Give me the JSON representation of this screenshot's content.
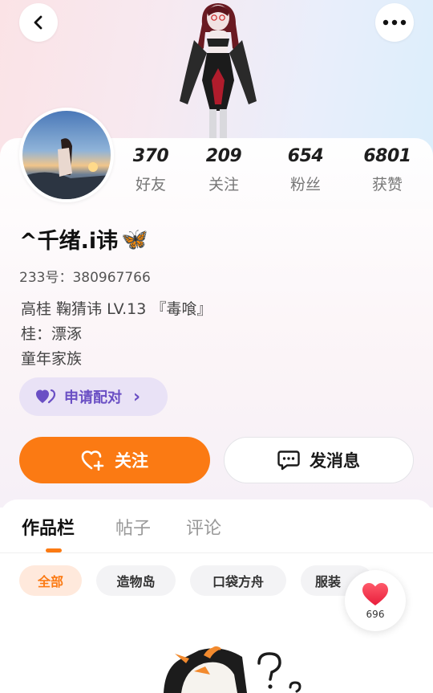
{
  "header": {
    "back_icon": "chevron-left-icon",
    "more_icon": "more-horizontal-icon"
  },
  "stats": [
    {
      "value": "370",
      "label": "好友"
    },
    {
      "value": "209",
      "label": "关注"
    },
    {
      "value": "654",
      "label": "粉丝"
    },
    {
      "value": "6801",
      "label": "获赞"
    }
  ],
  "profile": {
    "username": "^千绪.i讳",
    "username_emoji": "🦋",
    "id_line": "233号：380967766",
    "info_lines": [
      "高桂 鞠猜讳 LV.13 『毒喰』",
      "桂：漂涿",
      "童年家族"
    ]
  },
  "actions": {
    "pair_label": "申请配对",
    "pair_chevron": "›",
    "follow_label": "关注",
    "message_label": "发消息"
  },
  "tabs": [
    {
      "label": "作品栏",
      "active": true
    },
    {
      "label": "帖子",
      "active": false
    },
    {
      "label": "评论",
      "active": false
    }
  ],
  "filters": [
    {
      "label": "全部",
      "active": true
    },
    {
      "label": "造物岛",
      "active": false
    },
    {
      "label": "口袋方舟",
      "active": false
    },
    {
      "label": "服装",
      "active": false
    }
  ],
  "like_fab": {
    "count": "696",
    "icon": "heart-icon"
  },
  "colors": {
    "accent": "#fb7a13",
    "pair_purple": "#6a4fc4",
    "pair_bg": "#e9e2f6",
    "heart_red": "#f2334a"
  }
}
